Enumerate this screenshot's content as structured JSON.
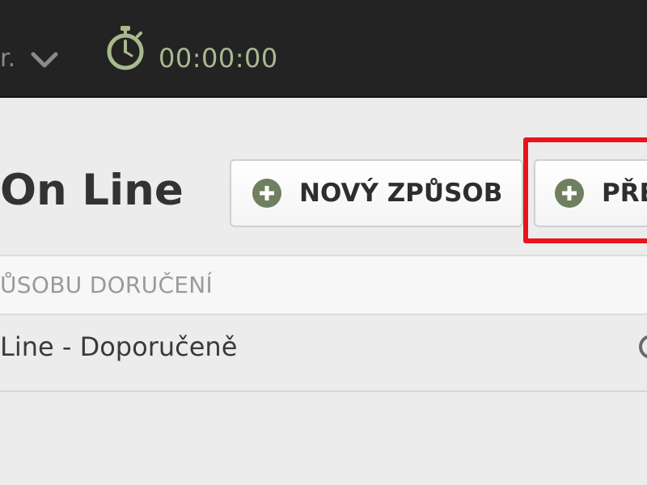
{
  "topbar": {
    "user_fragment": "r.",
    "timer": "00:00:00",
    "icons": [
      "chevron-down-icon",
      "stopwatch-icon"
    ]
  },
  "page": {
    "title": "On Line"
  },
  "toolbar": {
    "new_method_label": "NOVÝ ZPŮSOB",
    "second_button_label": "PŘE"
  },
  "table": {
    "columns": [
      "ŮSOBU DORUČENÍ"
    ],
    "rows": [
      {
        "name": "Line - Doporučeně"
      }
    ]
  },
  "colors": {
    "topbar_bg": "#232323",
    "timer_text": "#a9b98f",
    "accent_icon": "#6e8060",
    "highlight": "#e8131b",
    "page_bg": "#ececec"
  }
}
